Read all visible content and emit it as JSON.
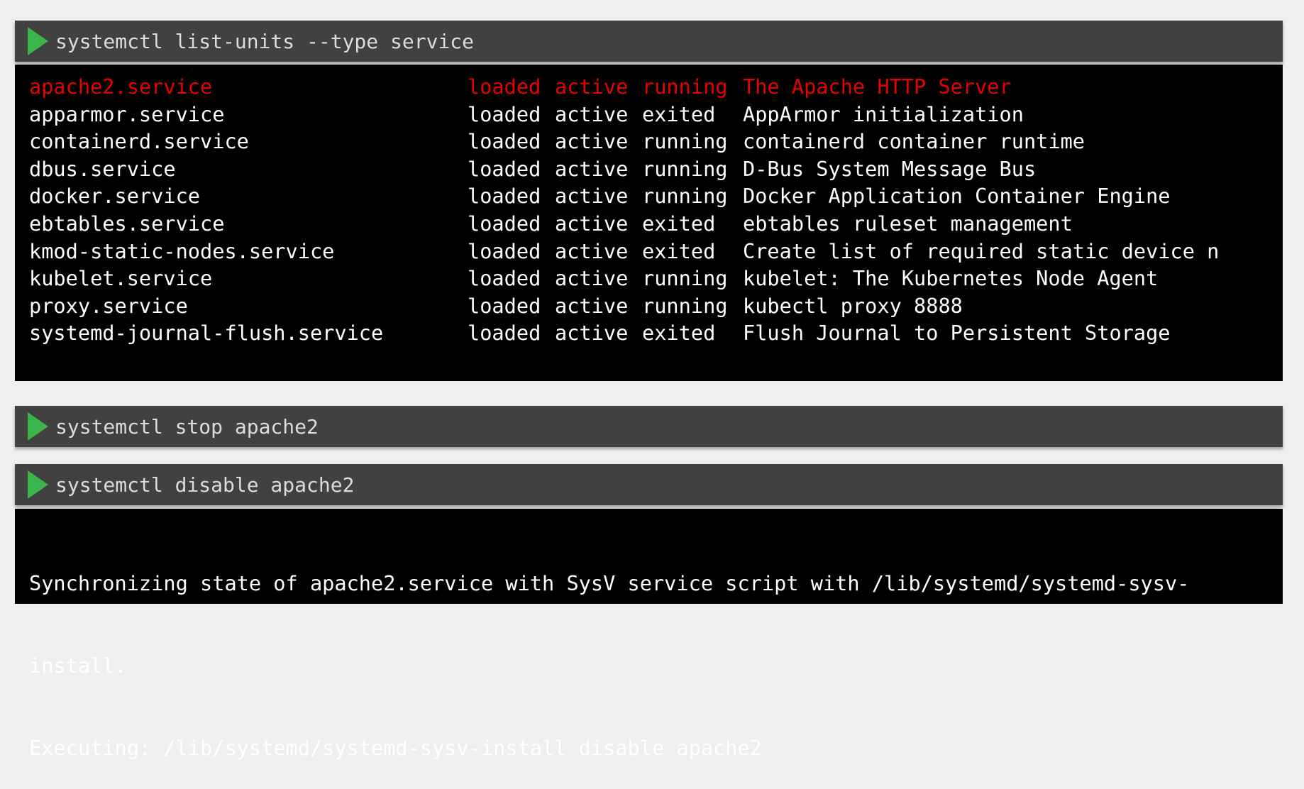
{
  "colors": {
    "prompt_icon": "#3bb54a",
    "highlight": "#e60000",
    "header_bg": "#414141",
    "output_bg": "#000000"
  },
  "prompt_icon": "play-triangle-icon",
  "commands": [
    {
      "text": "systemctl list-units --type service"
    },
    {
      "text": "systemctl stop apache2"
    },
    {
      "text": "systemctl disable apache2"
    }
  ],
  "units": [
    {
      "unit": "apache2.service",
      "load": "loaded",
      "active": "active",
      "sub": "running",
      "description": "The Apache HTTP Server",
      "highlighted": true
    },
    {
      "unit": "apparmor.service",
      "load": "loaded",
      "active": "active",
      "sub": "exited",
      "description": "AppArmor initialization"
    },
    {
      "unit": "containerd.service",
      "load": "loaded",
      "active": "active",
      "sub": "running",
      "description": "containerd container runtime"
    },
    {
      "unit": "dbus.service",
      "load": "loaded",
      "active": "active",
      "sub": "running",
      "description": "D-Bus System Message Bus"
    },
    {
      "unit": "docker.service",
      "load": "loaded",
      "active": "active",
      "sub": "running",
      "description": "Docker Application Container Engine"
    },
    {
      "unit": "ebtables.service",
      "load": "loaded",
      "active": "active",
      "sub": "exited",
      "description": "ebtables ruleset management"
    },
    {
      "unit": "kmod-static-nodes.service",
      "load": "loaded",
      "active": "active",
      "sub": "exited",
      "description": "Create list of required static device n"
    },
    {
      "unit": "kubelet.service",
      "load": "loaded",
      "active": "active",
      "sub": "running",
      "description": "kubelet: The Kubernetes Node Agent"
    },
    {
      "unit": "proxy.service",
      "load": "loaded",
      "active": "active",
      "sub": "running",
      "description": "kubectl proxy 8888"
    },
    {
      "unit": "systemd-journal-flush.service",
      "load": "loaded",
      "active": "active",
      "sub": "exited",
      "description": "Flush Journal to Persistent Storage"
    }
  ],
  "disable_output": [
    "Synchronizing state of apache2.service with SysV service script with /lib/systemd/systemd-sysv-",
    "install.",
    "Executing: /lib/systemd/systemd-sysv-install disable apache2"
  ]
}
